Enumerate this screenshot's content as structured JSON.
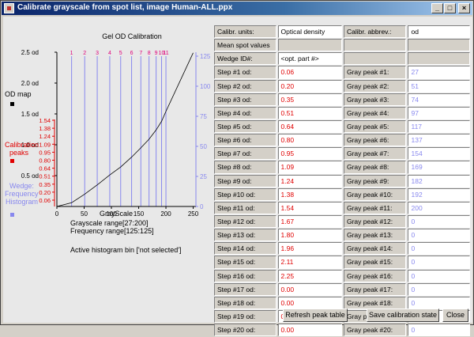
{
  "window": {
    "title": "Calibrate grayscale from spot list, image Human-ALL.ppx",
    "min": "_",
    "max": "□",
    "close": "×"
  },
  "chart": {
    "title": "Gel OD Calibration",
    "left_axis_ticks": [
      "2.5 od",
      "2.0 od",
      "1.5 od",
      "1.0 od",
      "0.5 od"
    ],
    "right_axis_ticks": [
      "125",
      "100",
      "75",
      "50",
      "25",
      "0"
    ],
    "x_ticks": [
      "0",
      "50",
      "100",
      "150",
      "200",
      "250"
    ],
    "xlabel": "GrayScale",
    "peak_markers": [
      "1",
      "2",
      "3",
      "4",
      "5",
      "6",
      "7",
      "8",
      "9",
      "10",
      "11"
    ],
    "calib_scale": [
      "1.54",
      "1.38",
      "1.24",
      "1.09",
      "0.95",
      "0.80",
      "0.64",
      "0.51",
      "0.35",
      "0.20",
      "0.06"
    ],
    "od_map_label": "OD map",
    "calib_peaks_label": "Calibration peaks",
    "wedge_label": "Wedge: Frequency Histogram",
    "grayscale_range": "Grayscale range[27:200]",
    "frequency_range": "Frequency range[125:125]",
    "active_bin": "Active histogram bin ['not selected']",
    "colors": {
      "od_axis": "#000000",
      "calib": "#e00000",
      "wedge": "#8888ee"
    },
    "chart_data": {
      "type": "line",
      "series": [
        {
          "name": "OD map",
          "x": [
            0,
            27,
            51,
            74,
            97,
            117,
            137,
            154,
            169,
            182,
            192,
            200,
            250
          ],
          "y": [
            0.0,
            0.06,
            0.2,
            0.35,
            0.51,
            0.64,
            0.8,
            0.95,
            1.09,
            1.24,
            1.38,
            1.54,
            2.49
          ]
        }
      ],
      "peaks_x": [
        27,
        51,
        74,
        97,
        117,
        137,
        154,
        169,
        182,
        192,
        200
      ],
      "xlim": [
        0,
        255
      ],
      "ylim": [
        0,
        2.5
      ]
    }
  },
  "table": {
    "header": {
      "units_label": "Calibr. units:",
      "units_value": "Optical density",
      "abbrev_label": "Calibr. abbrev.:",
      "abbrev_value": "od",
      "mean_label": "Mean spot values",
      "wedge_label": "Wedge ID#:",
      "wedge_value": "<opt. part #>"
    },
    "rows": [
      {
        "step": "Step #1 od:",
        "od": "0.06",
        "peak": "Gray peak #1:",
        "gray": "27"
      },
      {
        "step": "Step #2 od:",
        "od": "0.20",
        "peak": "Gray peak #2:",
        "gray": "51"
      },
      {
        "step": "Step #3 od:",
        "od": "0.35",
        "peak": "Gray peak #3:",
        "gray": "74"
      },
      {
        "step": "Step #4 od:",
        "od": "0.51",
        "peak": "Gray peak #4:",
        "gray": "97"
      },
      {
        "step": "Step #5 od:",
        "od": "0.64",
        "peak": "Gray peak #5:",
        "gray": "117"
      },
      {
        "step": "Step #6 od:",
        "od": "0.80",
        "peak": "Gray peak #6:",
        "gray": "137"
      },
      {
        "step": "Step #7 od:",
        "od": "0.95",
        "peak": "Gray peak #7:",
        "gray": "154"
      },
      {
        "step": "Step #8 od:",
        "od": "1.09",
        "peak": "Gray peak #8:",
        "gray": "169"
      },
      {
        "step": "Step #9 od:",
        "od": "1.24",
        "peak": "Gray peak #9:",
        "gray": "182"
      },
      {
        "step": "Step #10 od:",
        "od": "1.38",
        "peak": "Gray peak #10:",
        "gray": "192"
      },
      {
        "step": "Step #11 od:",
        "od": "1.54",
        "peak": "Gray peak #11:",
        "gray": "200"
      },
      {
        "step": "Step #12 od:",
        "od": "1.67",
        "peak": "Gray peak #12:",
        "gray": "0"
      },
      {
        "step": "Step #13 od:",
        "od": "1.80",
        "peak": "Gray peak #13:",
        "gray": "0"
      },
      {
        "step": "Step #14 od:",
        "od": "1.96",
        "peak": "Gray peak #14:",
        "gray": "0"
      },
      {
        "step": "Step #15 od:",
        "od": "2.11",
        "peak": "Gray peak #15:",
        "gray": "0"
      },
      {
        "step": "Step #16 od:",
        "od": "2.25",
        "peak": "Gray peak #16:",
        "gray": "0"
      },
      {
        "step": "Step #17 od:",
        "od": "0.00",
        "peak": "Gray peak #17:",
        "gray": "0"
      },
      {
        "step": "Step #18 od:",
        "od": "0.00",
        "peak": "Gray peak #18:",
        "gray": "0"
      },
      {
        "step": "Step #19 od:",
        "od": "0.00",
        "peak": "Gray peak #19:",
        "gray": "0"
      },
      {
        "step": "Step #20 od:",
        "od": "0.00",
        "peak": "Gray peak #20:",
        "gray": "0"
      }
    ]
  },
  "buttons": {
    "refresh": "Refresh peak table",
    "save": "Save calibration state",
    "close": "Close"
  }
}
